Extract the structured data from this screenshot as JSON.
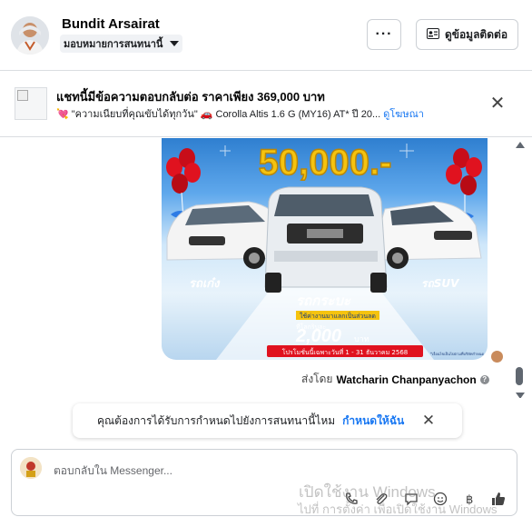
{
  "header": {
    "contact_name": "Bundit Arsairat",
    "assign_label": "มอบหมายการสนทนานี้",
    "more_label": "···",
    "contact_info_label": "ดูข้อมูลติดต่อ"
  },
  "ad": {
    "title": "แชทนี้มีข้อความตอบกลับต่อ ราคาเพียง 369,000 บาท",
    "subtitle": "\"ความเนียบที่คุณขับได้ทุกวัน\"",
    "car_model": "Corolla Altis 1.6 G (MY16) AT* ปี 20...",
    "link_label": "ดูโฆษณา"
  },
  "promo": {
    "headline": "50,000.-",
    "left_label": "รถเก๋ง",
    "mid_label": "รถกระบะ",
    "right_label": "รถSUV",
    "mid_sub": "ใช้ค่างานมาแลกเป็นส่วนลด",
    "mid_amount_prefix": "ที่โลกริบละ",
    "mid_amount": "2,000",
    "mid_unit": "บาท",
    "promo_period": "โปรโมชั่นนี้เฉพาะวันที่ 1 - 31 ธันวาคม 2568",
    "fineprint": "*เงื่อนไขเป็นไปตามที่บริษัทกำหนด"
  },
  "message": {
    "sent_by_prefix": "ส่งโดย",
    "sent_by_name": "Watcharin Chanpanyachon"
  },
  "assign_prompt": {
    "text": "คุณต้องการได้รับการกำหนดไปยังการสนทนานี้ไหม",
    "cta": "กำหนดให้ฉัน"
  },
  "composer": {
    "placeholder": "ตอบกลับใน Messenger..."
  },
  "watermark": {
    "line1": "เปิดใช้งาน Windows",
    "line2": "ไปที่ การตั้งค่า เพื่อเปิดใช้งาน Windows"
  },
  "colors": {
    "accent": "#1877f2",
    "border": "#dadde1",
    "promo_yellow": "#f5c30f",
    "promo_red": "#e0121f"
  }
}
